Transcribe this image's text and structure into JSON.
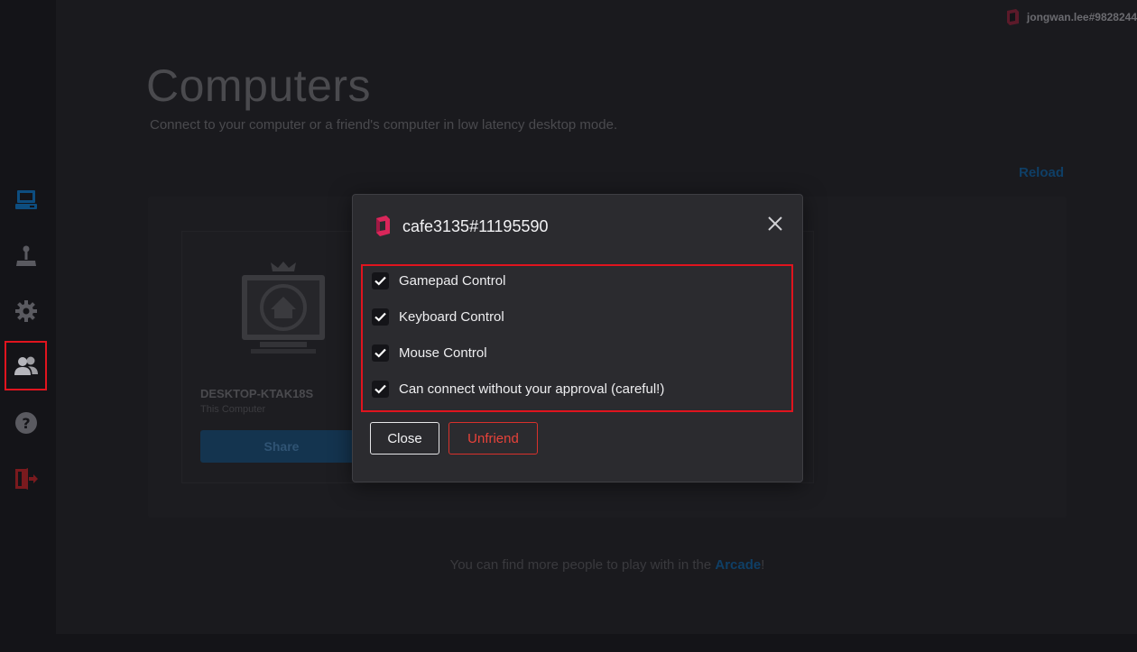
{
  "header": {
    "username": "jongwan.lee#9828244"
  },
  "page": {
    "title": "Computers",
    "subtitle": "Connect to your computer or a friend's computer in low latency desktop mode.",
    "reload_label": "Reload"
  },
  "sidebar": {
    "items": [
      {
        "name": "computers",
        "icon": "computer-icon"
      },
      {
        "name": "arcade",
        "icon": "joystick-icon"
      },
      {
        "name": "settings",
        "icon": "gear-icon"
      },
      {
        "name": "friends",
        "icon": "friends-icon",
        "selected": true
      },
      {
        "name": "help",
        "icon": "help-icon"
      },
      {
        "name": "logout",
        "icon": "logout-icon"
      }
    ]
  },
  "card": {
    "name": "DESKTOP-KTAK18S",
    "subtitle": "This Computer",
    "share_label": "Share"
  },
  "footer": {
    "text_before": "You can find more people to play with in the ",
    "link": "Arcade",
    "text_after": "!"
  },
  "modal": {
    "title": "cafe3135#11195590",
    "permissions": [
      {
        "label": "Gamepad Control",
        "checked": true
      },
      {
        "label": "Keyboard Control",
        "checked": true
      },
      {
        "label": "Mouse Control",
        "checked": true
      },
      {
        "label": "Can connect without your approval (careful!)",
        "checked": true
      }
    ],
    "close_label": "Close",
    "unfriend_label": "Unfriend"
  },
  "colors": {
    "accent_red": "#e0141e",
    "link_blue": "#0f3f66",
    "modal_bg": "#2b2b2f"
  }
}
